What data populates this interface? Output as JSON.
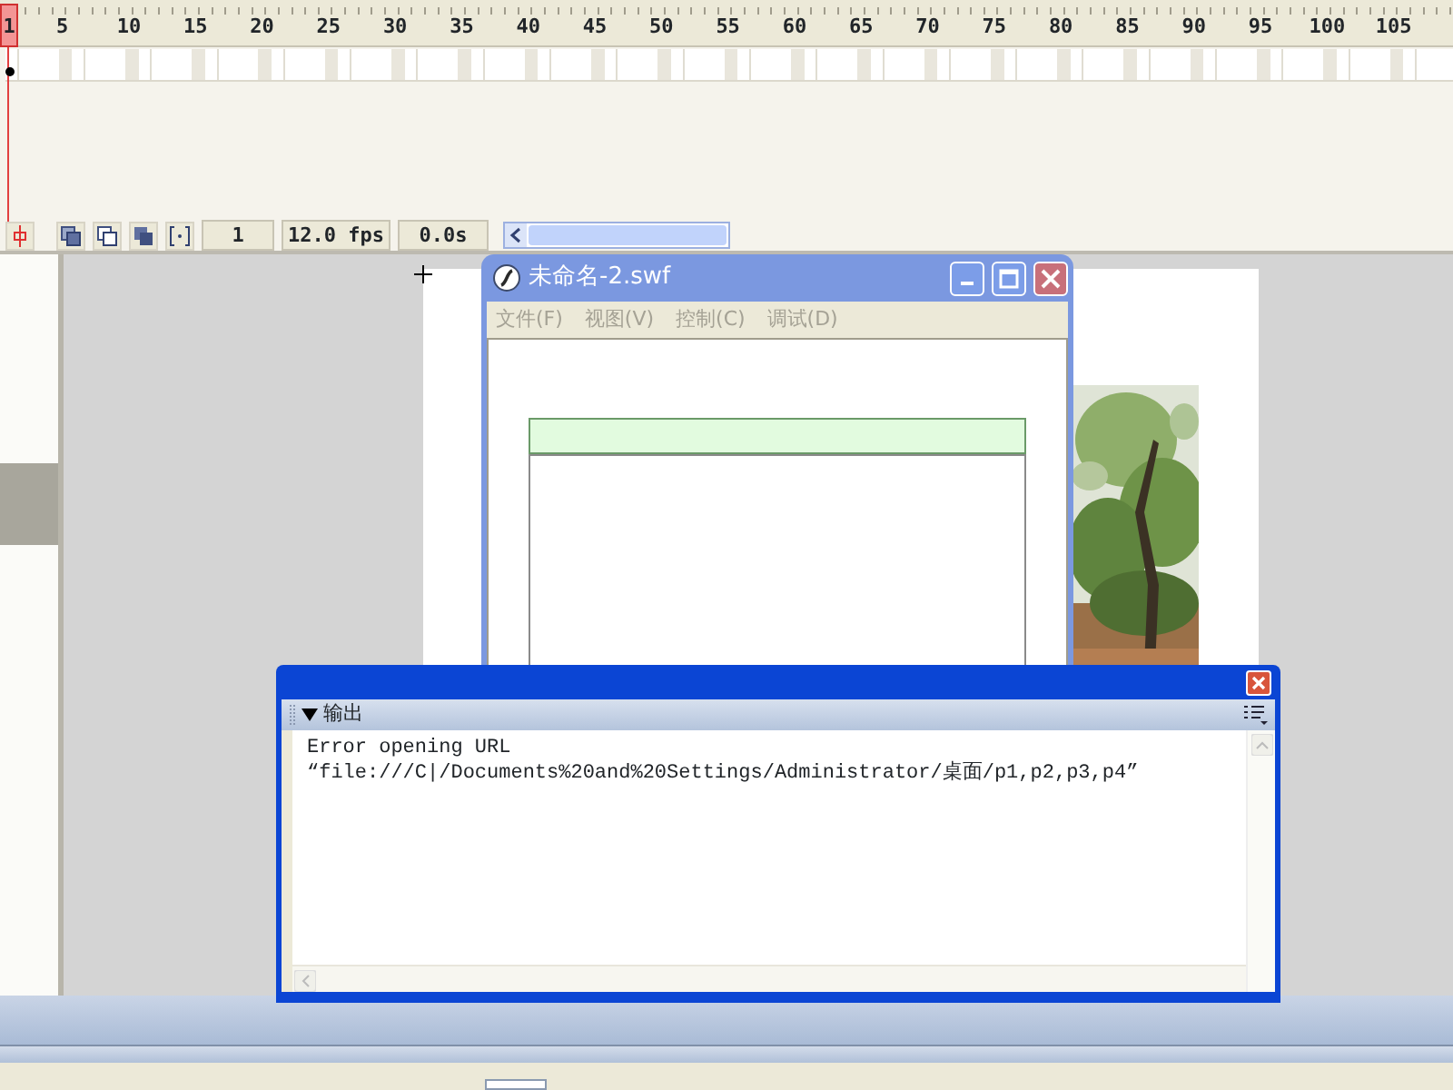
{
  "timeline": {
    "ruler": [
      "1",
      "5",
      "10",
      "15",
      "20",
      "25",
      "30",
      "35",
      "40",
      "45",
      "50",
      "55",
      "60",
      "65",
      "70",
      "75",
      "80",
      "85",
      "90",
      "95",
      "100",
      "105"
    ],
    "current_frame": "1",
    "frame_rate": "12.0 fps",
    "elapsed": "0.0s"
  },
  "player_window": {
    "title": "未命名-2.swf",
    "menu": [
      {
        "label": "文件(F)",
        "disabled": true
      },
      {
        "label": "视图(V)",
        "disabled": true
      },
      {
        "label": "控制(C)",
        "disabled": true
      },
      {
        "label": "调试(D)",
        "disabled": true
      }
    ]
  },
  "output_panel": {
    "title": "输出",
    "expanded": true,
    "lines": [
      "Error opening URL",
      "“file:///C|/Documents%20and%20Settings/Administrator/桌面/p1,p2,p3,p4”"
    ]
  }
}
